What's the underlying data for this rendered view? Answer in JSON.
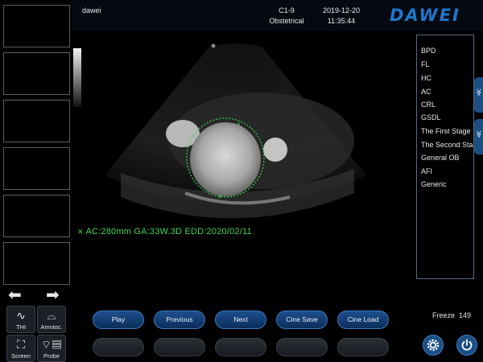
{
  "header": {
    "user": "dawei",
    "probe": "C1-9",
    "mode": "Obstetrical",
    "date": "2019-12-20",
    "time": "11:35:44",
    "logo": "DAWEI"
  },
  "measurement_readout": "AC:280mm GA:33W.3D EDD:2020/02/11",
  "measurement_list": [
    "BPD",
    "FL",
    "HC",
    "AC",
    "CRL",
    "GSDL",
    "The First Stage",
    "The Second Sta",
    "General OB",
    "AFI",
    "Generic"
  ],
  "tools": {
    "thi_label": "THI",
    "amnioc_label": "Amnioc.",
    "screen_label": "Screen",
    "probe_label": "Probe"
  },
  "cine_buttons": [
    "Play",
    "Previous",
    "Next",
    "Cine Save",
    "Cine Load"
  ],
  "freeze": {
    "label": "Freeze",
    "value": "149"
  },
  "colors": {
    "accent": "#1f76c9",
    "measure": "#39d64a",
    "button": "#1d4f8d"
  },
  "icons": [
    "arrow-left-icon",
    "arrow-right-icon",
    "thi-icon",
    "amnioc-icon",
    "screen-icon",
    "probe-icon",
    "settings-icon",
    "power-icon"
  ]
}
